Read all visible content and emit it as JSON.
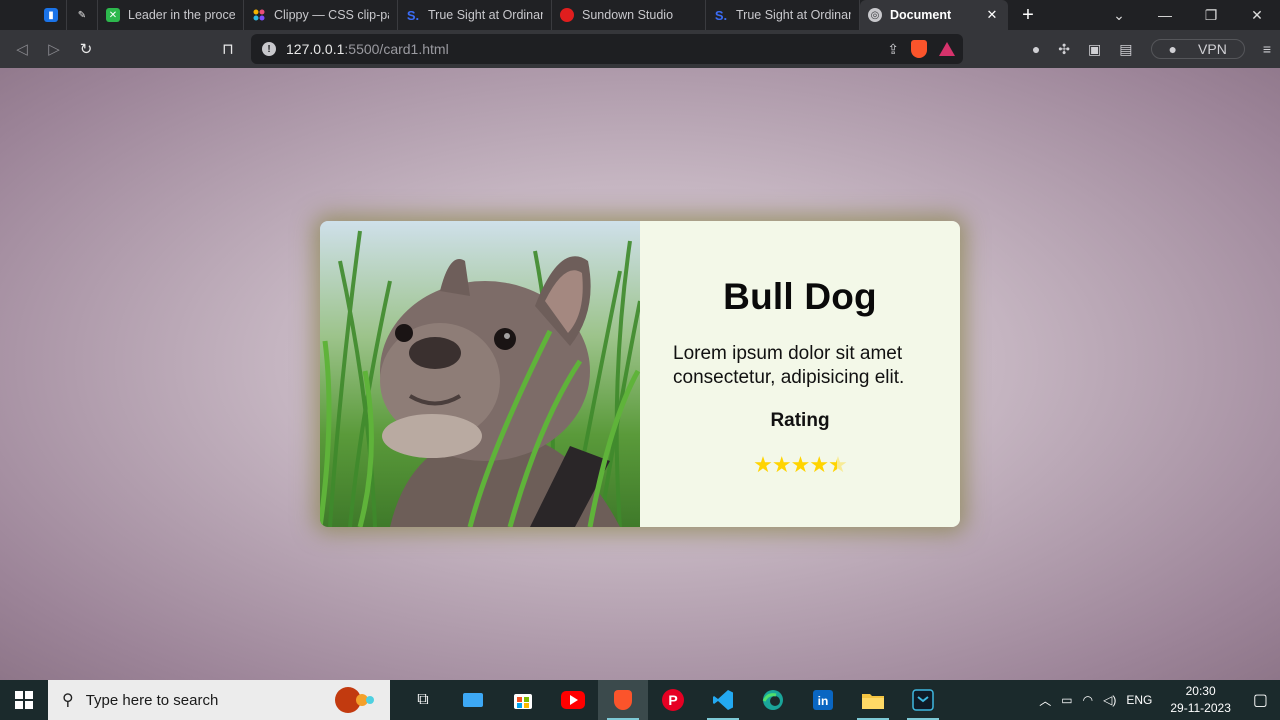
{
  "browser": {
    "tabs": [
      {
        "title": "",
        "favicon": "calendar-favicon",
        "pinned": true,
        "color": "#1a73e8"
      },
      {
        "title": "",
        "favicon": "feather-favicon",
        "pinned": true,
        "color": "#e8e8e8"
      },
      {
        "title": "Leader in the process",
        "favicon": "x-favicon",
        "color": "#2db84d"
      },
      {
        "title": "Clippy — CSS clip-path",
        "favicon": "clippy-favicon",
        "color": "#e94e77"
      },
      {
        "title": "True Sight at Ordinary",
        "favicon": "s-favicon",
        "color": "#1d4ed8"
      },
      {
        "title": "Sundown Studio",
        "favicon": "sundown-favicon",
        "color": "#e01e1e"
      },
      {
        "title": "True Sight at Ordinary",
        "favicon": "s-favicon",
        "color": "#1d4ed8"
      },
      {
        "title": "Document",
        "favicon": "globe-favicon",
        "active": true,
        "color": "#c8c8cc"
      }
    ],
    "new_tab": "+",
    "address": {
      "host": "127.0.0.1",
      "rest": ":5500/card1.html"
    },
    "vpn_label": "VPN",
    "brand_color": "#fb542b"
  },
  "page": {
    "card": {
      "title": "Bull Dog",
      "description": "Lorem ipsum dolor sit amet consectetur, adipisicing elit.",
      "rating_label": "Rating",
      "rating_value": 4.5,
      "rating_max": 5,
      "image_subject": "french-bulldog-in-grass"
    }
  },
  "taskbar": {
    "search_placeholder": "Type here to search",
    "apps": [
      "task-view-icon",
      "laptop-icon",
      "microsoft-store-icon",
      "youtube-icon",
      "brave-icon",
      "pinterest-icon",
      "vscode-icon",
      "edge-icon",
      "linkedin-icon",
      "file-explorer-icon",
      "capture-icon"
    ],
    "language": "ENG",
    "time": "20:30",
    "date": "29-11-2023"
  }
}
